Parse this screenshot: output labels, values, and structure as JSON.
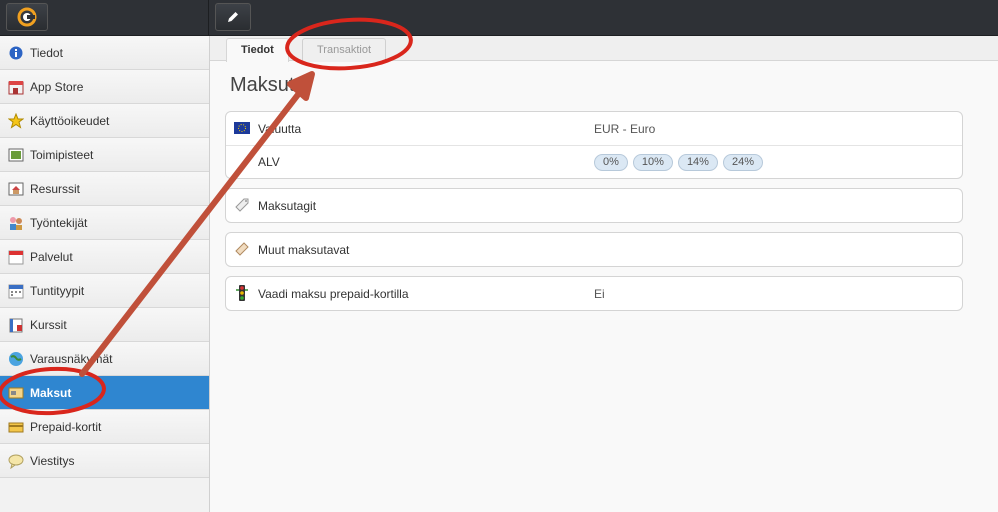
{
  "header": {
    "logo_icon": "app-logo-icon",
    "edit_icon": "pencil-icon"
  },
  "sidebar": {
    "items": [
      {
        "label": "Tiedot",
        "icon": "info-icon"
      },
      {
        "label": "App Store",
        "icon": "store-icon"
      },
      {
        "label": "Käyttöoikeudet",
        "icon": "star-icon"
      },
      {
        "label": "Toimipisteet",
        "icon": "location-icon"
      },
      {
        "label": "Resurssit",
        "icon": "resource-icon"
      },
      {
        "label": "Työntekijät",
        "icon": "users-icon"
      },
      {
        "label": "Palvelut",
        "icon": "calendar-icon"
      },
      {
        "label": "Tuntityypit",
        "icon": "calendar-grid-icon"
      },
      {
        "label": "Kurssit",
        "icon": "book-icon"
      },
      {
        "label": "Varausnäkymät",
        "icon": "globe-icon"
      },
      {
        "label": "Maksut",
        "icon": "payment-icon",
        "active": true
      },
      {
        "label": "Prepaid-kortit",
        "icon": "card-icon"
      },
      {
        "label": "Viestitys",
        "icon": "message-icon"
      }
    ]
  },
  "tabs": [
    {
      "label": "Tiedot",
      "active": true
    },
    {
      "label": "Transaktiot",
      "active": false
    }
  ],
  "main": {
    "title": "Maksut",
    "currency": {
      "label": "Valuutta",
      "value": "EUR - Euro",
      "icon": "eu-flag-icon"
    },
    "vat": {
      "label": "ALV",
      "rates": [
        "0%",
        "10%",
        "14%",
        "24%"
      ]
    },
    "tags": {
      "label": "Maksutagit",
      "icon": "tag-icon"
    },
    "other": {
      "label": "Muut maksutavat",
      "icon": "ticket-icon"
    },
    "prepaid": {
      "label": "Vaadi maksu prepaid-kortilla",
      "value": "Ei",
      "icon": "traffic-light-icon"
    }
  },
  "colors": {
    "active_item": "#2f86d0",
    "annotation": "#d9261c",
    "arrow": "#c0503a"
  }
}
